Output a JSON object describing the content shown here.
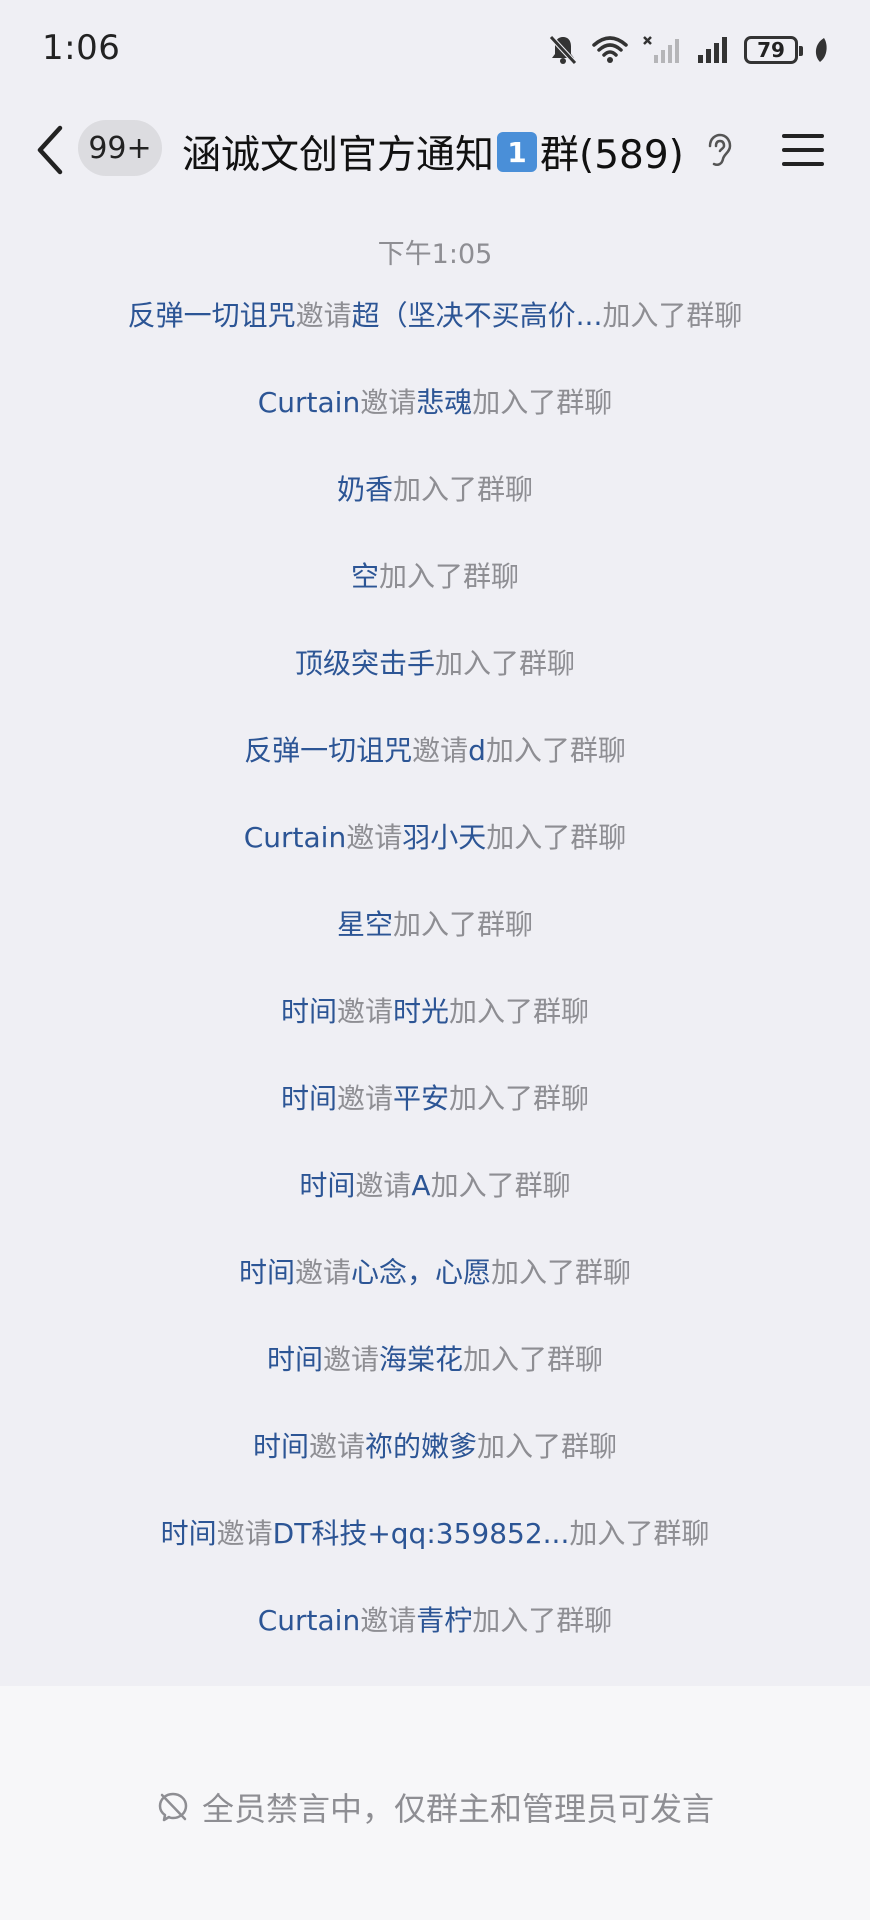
{
  "status_bar": {
    "time": "1:06",
    "battery": "79"
  },
  "header": {
    "unread_badge": "99+",
    "title_prefix": "涵诚文创官方通知",
    "title_keycap": "1",
    "title_suffix": "群(589)"
  },
  "timestamp": "下午1:05",
  "messages": [
    {
      "actor": "反弹一切诅咒",
      "verb": "邀请",
      "target": "超（坚决不买高价...",
      "suffix": "加入了群聊"
    },
    {
      "actor": "Curtain",
      "verb": "邀请",
      "target": "悲魂",
      "suffix": "加入了群聊"
    },
    {
      "actor": "奶香",
      "verb": "",
      "target": "",
      "suffix": "加入了群聊"
    },
    {
      "actor": "空",
      "verb": "",
      "target": "",
      "suffix": "加入了群聊"
    },
    {
      "actor": "顶级突击手",
      "verb": "",
      "target": "",
      "suffix": "加入了群聊"
    },
    {
      "actor": "反弹一切诅咒",
      "verb": "邀请",
      "target": "d",
      "suffix": "加入了群聊"
    },
    {
      "actor": "Curtain",
      "verb": "邀请",
      "target": "羽小天",
      "suffix": "加入了群聊"
    },
    {
      "actor": "星空",
      "verb": "",
      "target": "",
      "suffix": "加入了群聊"
    },
    {
      "actor": "时间",
      "verb": "邀请",
      "target": "时光",
      "suffix": "加入了群聊"
    },
    {
      "actor": "时间",
      "verb": "邀请",
      "target": "平安",
      "suffix": "加入了群聊"
    },
    {
      "actor": "时间",
      "verb": "邀请",
      "target": "A",
      "suffix": "加入了群聊"
    },
    {
      "actor": "时间",
      "verb": "邀请",
      "target": "心念，心愿",
      "suffix": "加入了群聊"
    },
    {
      "actor": "时间",
      "verb": "邀请",
      "target": "海棠花",
      "suffix": "加入了群聊"
    },
    {
      "actor": "时间",
      "verb": "邀请",
      "target": "祢的嫩爹",
      "suffix": "加入了群聊"
    },
    {
      "actor": "时间",
      "verb": "邀请",
      "target": "DT科技+qq:359852...",
      "suffix": "加入了群聊"
    },
    {
      "actor": "Curtain",
      "verb": "邀请",
      "target": "青柠",
      "suffix": "加入了群聊"
    }
  ],
  "mute_notice": "全员禁言中，仅群主和管理员可发言"
}
